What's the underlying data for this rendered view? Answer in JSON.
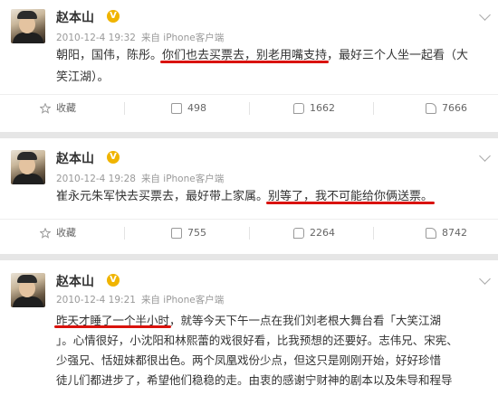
{
  "posts": [
    {
      "author": "赵本山",
      "verified_badge": "V",
      "time": "2010-12-4 19:32",
      "source": "来自 iPhone客户端",
      "text_lines": [
        [
          "朝阳，国伟，陈彤。",
          "你们也去买票去，别老用嘴支持",
          "，最好三个人坐一起看（大"
        ],
        [
          "笑江湖）。"
        ]
      ],
      "favorite_label": "收藏",
      "reposts": "498",
      "comments": "1662",
      "likes": "7666"
    },
    {
      "author": "赵本山",
      "verified_badge": "V",
      "time": "2010-12-4 19:28",
      "source": "来自 iPhone客户端",
      "text_lines": [
        [
          "崔永元朱军快去买票去，最好带上家属。",
          "别等了，我不可能给你俩送票。",
          ""
        ]
      ],
      "favorite_label": "收藏",
      "reposts": "755",
      "comments": "2264",
      "likes": "8742"
    },
    {
      "author": "赵本山",
      "verified_badge": "V",
      "time": "2010-12-4 19:21",
      "source": "来自 iPhone客户端",
      "text_lines": [
        [
          "",
          "昨天才睡了一个半小时",
          "，就等今天下午一点在我们刘老根大舞台看「大笑江湖"
        ],
        [
          "」。心情很好，小沈阳和林熙蕾的戏很好看，比我预想的还要好。志伟兄、宋宪、"
        ],
        [
          "少强兄、恬妞妹都很出色。两个凤凰戏份少点，但这只是刚刚开始，好好珍惜"
        ],
        [
          "徒儿们都进步了，希望他们稳稳的走。由衷的感谢宁财神的剧本以及朱导和程导"
        ]
      ]
    }
  ]
}
